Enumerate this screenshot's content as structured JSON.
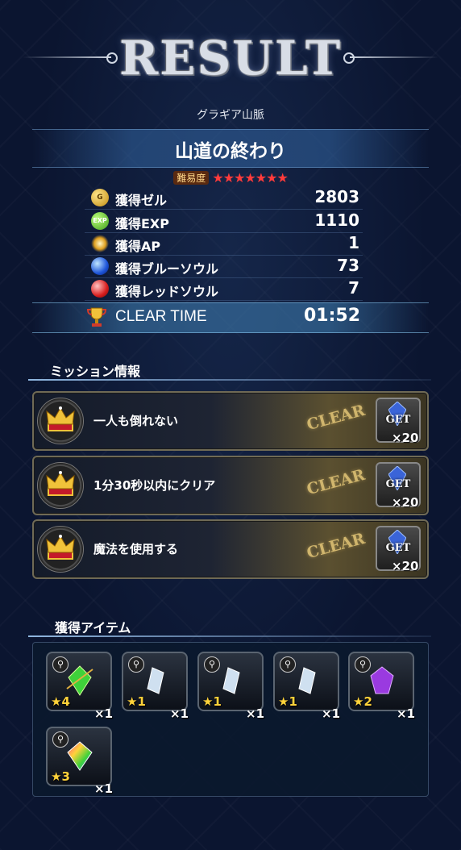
{
  "header": {
    "title": "RESULT",
    "region": "グラギア山脈",
    "stage_name": "山道の終わり"
  },
  "difficulty": {
    "label": "難易度",
    "stars": "★★★★★★★",
    "count": 7
  },
  "rewards": [
    {
      "label": "獲得ゼル",
      "value": "2803",
      "icon": "gil-coin-icon"
    },
    {
      "label": "獲得EXP",
      "value": "1110",
      "icon": "exp-icon"
    },
    {
      "label": "獲得AP",
      "value": "1",
      "icon": "ap-sparkle-icon"
    },
    {
      "label": "獲得ブルーソウル",
      "value": "73",
      "icon": "blue-soul-icon"
    },
    {
      "label": "獲得レッドソウル",
      "value": "7",
      "icon": "red-soul-icon"
    }
  ],
  "clear": {
    "label": "CLEAR TIME",
    "value": "01:52",
    "icon": "trophy-icon"
  },
  "missions_section": {
    "title": "ミッション情報"
  },
  "missions": [
    {
      "text": "一人も倒れない",
      "status": "CLEAR",
      "reward_label": "GET",
      "reward_qty": "×20"
    },
    {
      "text": "1分30秒以内にクリア",
      "status": "CLEAR",
      "reward_label": "GET",
      "reward_qty": "×20"
    },
    {
      "text": "魔法を使用する",
      "status": "CLEAR",
      "reward_label": "GET",
      "reward_qty": "×20"
    }
  ],
  "items_section": {
    "title": "獲得アイテム"
  },
  "items": [
    {
      "rarity": "★4",
      "qty": "×1",
      "color": "#3fd23a"
    },
    {
      "rarity": "★1",
      "qty": "×1",
      "color": "#cfe0f0"
    },
    {
      "rarity": "★1",
      "qty": "×1",
      "color": "#cfe0f0"
    },
    {
      "rarity": "★1",
      "qty": "×1",
      "color": "#cfe0f0"
    },
    {
      "rarity": "★2",
      "qty": "×1",
      "color": "#9a3ae0"
    },
    {
      "rarity": "★3",
      "qty": "×1",
      "color": "#ff5ab0"
    }
  ],
  "colors": {
    "background": "#0b1530",
    "difficulty_star": "#ff3b3b",
    "rarity_star": "#ffd23a",
    "clear_stamp": "#e6c878"
  }
}
